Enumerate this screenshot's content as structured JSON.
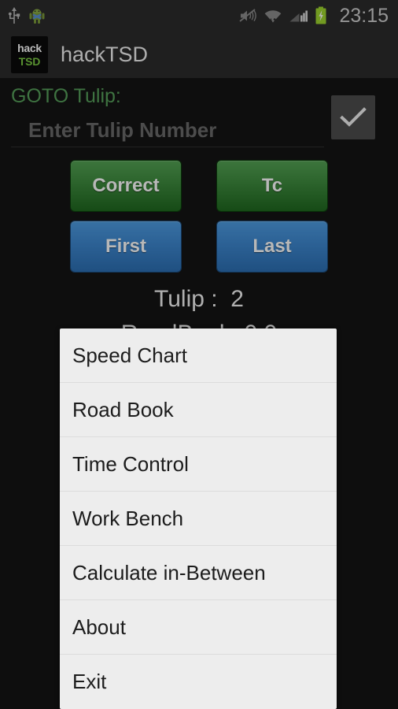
{
  "status_bar": {
    "clock": "23:15",
    "icons": [
      {
        "name": "usb-icon",
        "label": "USB"
      },
      {
        "name": "android-debug-icon",
        "label": "Android"
      },
      {
        "name": "ringer-vibrate-off-icon",
        "label": "Silent/Vibrate"
      },
      {
        "name": "wifi-icon",
        "label": "Wi-Fi"
      },
      {
        "name": "cellular-signal-icon",
        "label": "Signal"
      },
      {
        "name": "battery-charging-icon",
        "label": "Battery charging"
      }
    ]
  },
  "action_bar": {
    "app_icon_top": "hack",
    "app_icon_bottom": "TSD",
    "title": "hackTSD"
  },
  "goto": {
    "label": "GOTO Tulip:",
    "input_value": "",
    "input_placeholder": "Enter Tulip Number",
    "confirm_icon": "check-icon"
  },
  "buttons": [
    {
      "label": "Correct",
      "name": "correct-button",
      "style": "green"
    },
    {
      "label": "Tc",
      "name": "tc-button",
      "style": "green"
    },
    {
      "label": "First",
      "name": "first-button",
      "style": "blue"
    },
    {
      "label": "Last",
      "name": "last-button",
      "style": "blue"
    }
  ],
  "readout": {
    "tulip": "Tulip :  2",
    "roadbook": "RoadBook: 0.0"
  },
  "menu": {
    "items": [
      {
        "label": "Speed Chart",
        "name": "menu-item-speed-chart"
      },
      {
        "label": "Road Book",
        "name": "menu-item-road-book"
      },
      {
        "label": "Time Control",
        "name": "menu-item-time-control"
      },
      {
        "label": "Work Bench",
        "name": "menu-item-work-bench"
      },
      {
        "label": "Calculate in-Between",
        "name": "menu-item-calculate-in-between"
      },
      {
        "label": "About",
        "name": "menu-item-about"
      },
      {
        "label": "Exit",
        "name": "menu-item-exit"
      }
    ]
  },
  "colors": {
    "accent_green": "#57a05a",
    "logo_green": "#7ac943",
    "button_green": "#3d8a3d",
    "button_blue": "#3d87cf",
    "background": "#141414",
    "bar_background": "#2b2b2b",
    "menu_background": "#ededed"
  }
}
